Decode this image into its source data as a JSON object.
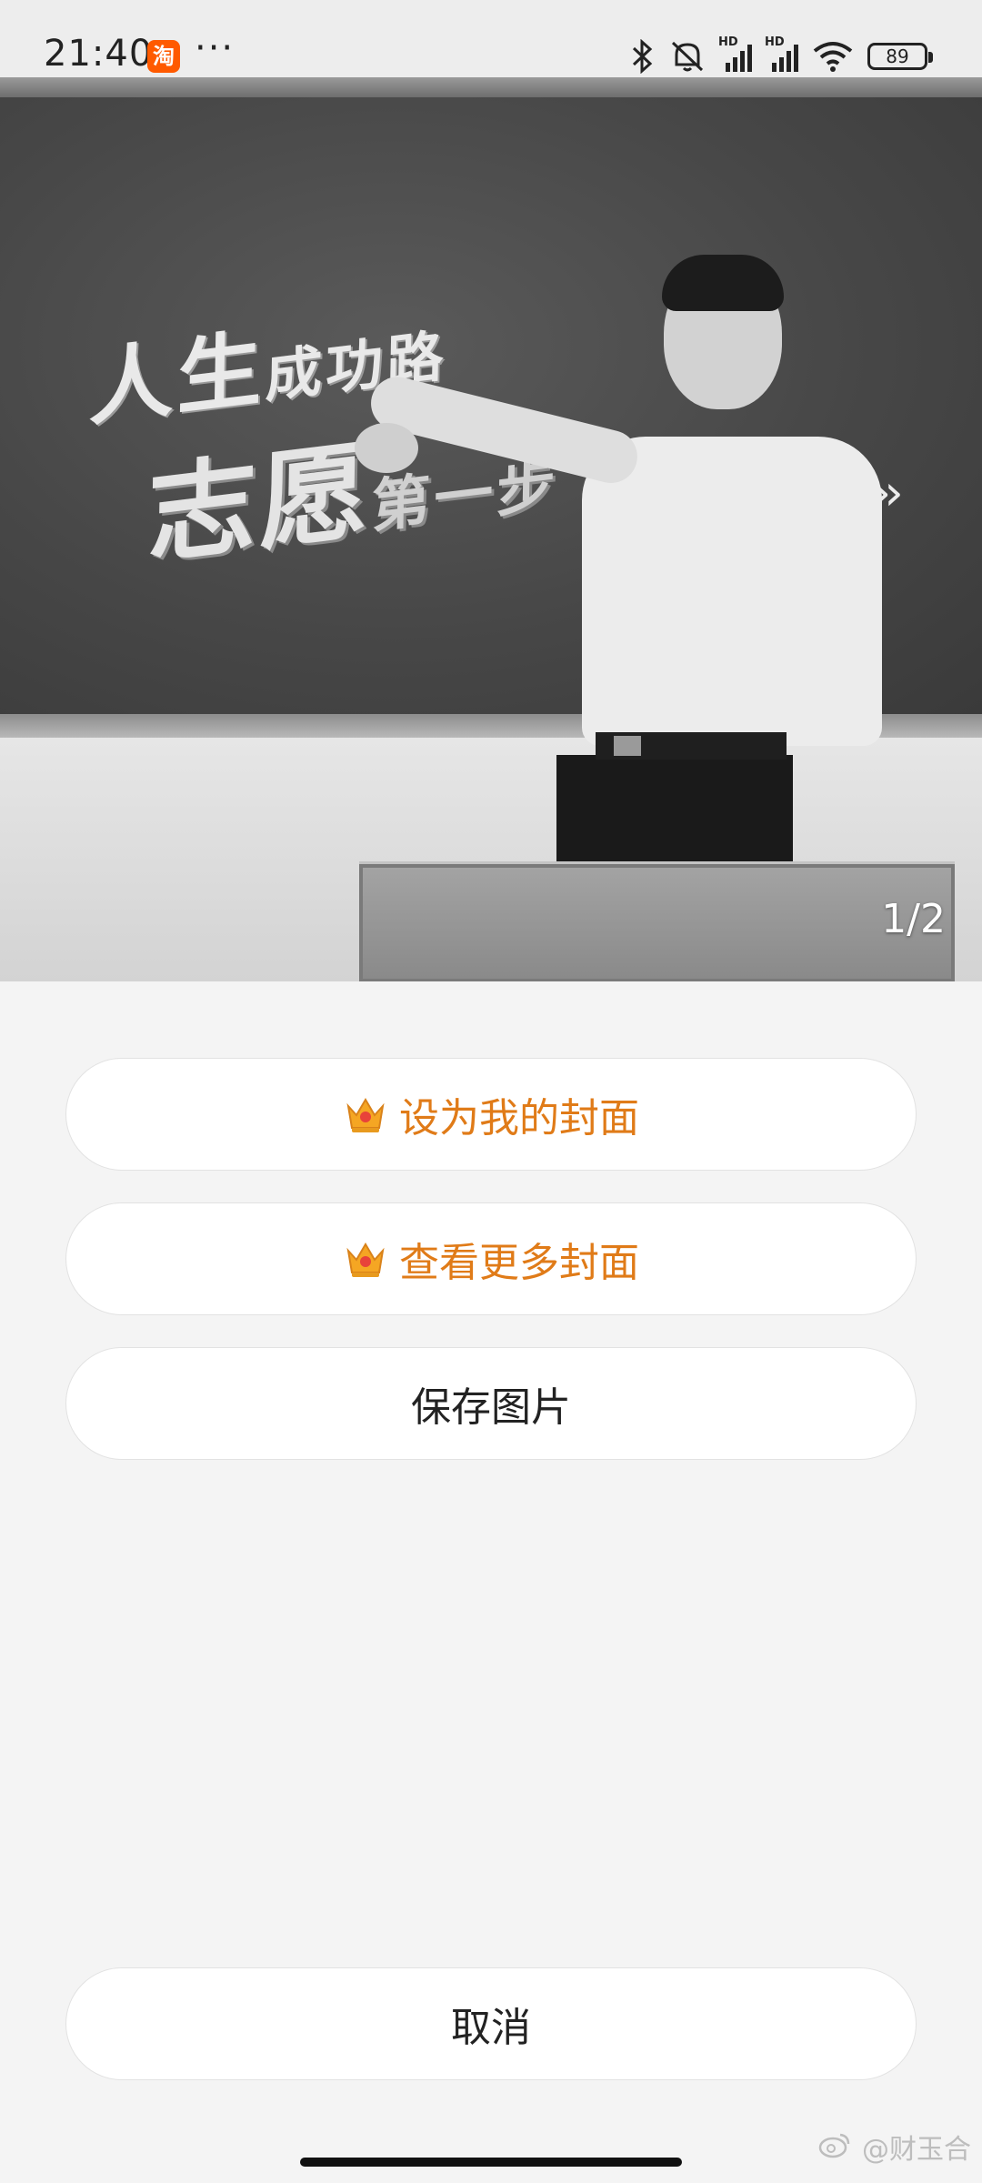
{
  "status_bar": {
    "time": "21:40",
    "app_badge": "淘",
    "more": "···",
    "signal_label_1": "HD",
    "signal_label_2": "HD",
    "battery": "89"
  },
  "cover": {
    "slogan_line1_big": "人生",
    "slogan_line1_small": "成功路",
    "slogan_line2_big": "志愿",
    "slogan_line2_small": "第一步",
    "arrows": "›››",
    "page_indicator": "1/2"
  },
  "actions": {
    "set_cover": "设为我的封面",
    "more_covers": "查看更多封面",
    "save_image": "保存图片",
    "cancel": "取消"
  },
  "watermark": "@财玉合",
  "colors": {
    "accent_orange": "#e07b18",
    "background": "#f4f4f4",
    "button_bg": "#ffffff"
  }
}
